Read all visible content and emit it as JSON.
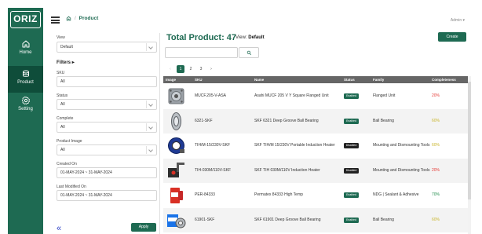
{
  "app": {
    "logo": "ORIZ"
  },
  "nav": [
    {
      "label": "Home",
      "icon": "home-icon"
    },
    {
      "label": "Product",
      "icon": "product-icon",
      "active": true
    },
    {
      "label": "Setting",
      "icon": "gear-icon"
    }
  ],
  "topbar": {
    "breadcrumb_current": "Product",
    "separator": "/",
    "user": "Admin ▾"
  },
  "filters": {
    "view_label": "View",
    "view_value": "Default",
    "heading": "Filters",
    "sku_label": "SKU",
    "sku_value": "All",
    "status_label": "Status",
    "status_value": "All",
    "complete_label": "Complete",
    "complete_value": "All",
    "image_label": "Product Image",
    "image_value": "All",
    "created_label": "Created On",
    "created_value": "01-MAY-2024 ~ 31-MAY-2024",
    "modified_label": "Last Modified On",
    "modified_value": "01-MAY-2024 ~ 31-MAY-2024",
    "collapse_glyph": "«",
    "apply_label": "Apply"
  },
  "main": {
    "total_label": "Total Product: 47",
    "view_prefix": "View:",
    "view_name": "Default",
    "create_label": "Create",
    "pagination": {
      "prev": "‹",
      "pages": [
        "1",
        "2",
        "3"
      ],
      "active": "1",
      "next": "›"
    }
  },
  "table": {
    "columns": [
      "Image",
      "SKU",
      "Name",
      "Status",
      "Family",
      "Completeness"
    ],
    "rows": [
      {
        "sku": "MUCF.205-V-ASA",
        "name": "Asahi MUCF 205 V Y Square Flanged Unit",
        "status": "Enabled",
        "family": "Flanged Unit",
        "completeness": "20%",
        "completeness_color": "#e53935",
        "thumb": "flange"
      },
      {
        "sku": "6321-SKF",
        "name": "SKF 6321 Deep Groove Ball Bearing",
        "status": "Enabled",
        "family": "Ball Bearing",
        "completeness": "60%",
        "completeness_color": "#c9b52a",
        "thumb": "bearing-side"
      },
      {
        "sku": "TIH/M-15/230V-SKF",
        "name": "SKF TIH/M 15/230V Portable Induction Heater",
        "status": "Disabled",
        "family": "Mounting and Dismounting Tools",
        "completeness": "60%",
        "completeness_color": "#c9b52a",
        "thumb": "heater"
      },
      {
        "sku": "TIH-030M/110V-SKF",
        "name": "SKF TIH 030M/110V Induction Heater",
        "status": "Disabled",
        "family": "Mounting and Dismounting Tools",
        "completeness": "20%",
        "completeness_color": "#e53935",
        "thumb": "heater-arm"
      },
      {
        "sku": "PER-84333",
        "name": "Permatex 84333 High Temp",
        "status": "Enabled",
        "family": "NDG | Sealant & Adhesive",
        "completeness": "70%",
        "completeness_color": "#1e8a4a",
        "thumb": "sealant"
      },
      {
        "sku": "61901-SKF",
        "name": "SKF 61901 Deep Groove Ball Bearing",
        "status": "Enabled",
        "family": "Ball Bearing",
        "completeness": "60%",
        "completeness_color": "#c9b52a",
        "thumb": "bearing-box"
      }
    ]
  }
}
